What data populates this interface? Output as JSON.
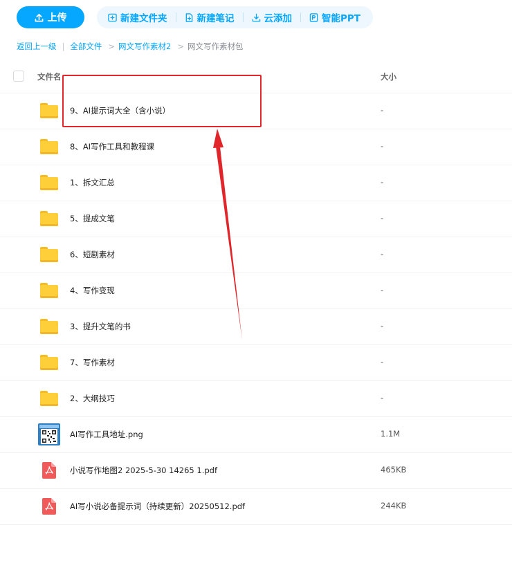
{
  "toolbar": {
    "upload_label": "上传",
    "actions": [
      {
        "label": "新建文件夹",
        "icon": "folder-plus-icon"
      },
      {
        "label": "新建笔记",
        "icon": "note-plus-icon"
      },
      {
        "label": "云添加",
        "icon": "cloud-download-icon"
      },
      {
        "label": "智能PPT",
        "icon": "ppt-icon"
      }
    ]
  },
  "breadcrumb": {
    "back": "返回上一级",
    "divider": "|",
    "items": [
      "全部文件",
      "网文写作素材2"
    ],
    "current": "网文写作素材包",
    "arrow": ">"
  },
  "table": {
    "col_name": "文件名",
    "col_size": "大小",
    "rows": [
      {
        "name": "9、AI提示词大全（含小说）",
        "size": "-",
        "type": "folder"
      },
      {
        "name": "8、AI写作工具和教程课",
        "size": "-",
        "type": "folder"
      },
      {
        "name": "1、拆文汇总",
        "size": "-",
        "type": "folder"
      },
      {
        "name": "5、提成文笔",
        "size": "-",
        "type": "folder"
      },
      {
        "name": "6、短剧素材",
        "size": "-",
        "type": "folder"
      },
      {
        "name": "4、写作变现",
        "size": "-",
        "type": "folder"
      },
      {
        "name": "3、提升文笔的书",
        "size": "-",
        "type": "folder"
      },
      {
        "name": "7、写作素材",
        "size": "-",
        "type": "folder"
      },
      {
        "name": "2、大纲技巧",
        "size": "-",
        "type": "folder"
      },
      {
        "name": "AI写作工具地址.png",
        "size": "1.1M",
        "type": "image"
      },
      {
        "name": "小说写作地图2 2025-5-30 14265 1.pdf",
        "size": "465KB",
        "type": "pdf"
      },
      {
        "name": "AI写小说必备提示词（持续更新）20250512.pdf",
        "size": "244KB",
        "type": "pdf"
      }
    ]
  },
  "colors": {
    "accent": "#06a7ff",
    "accent_bg": "#eef7fe",
    "folder": "#ffcf3a",
    "pdf": "#f05a5a",
    "annotation": "#e0262a"
  }
}
